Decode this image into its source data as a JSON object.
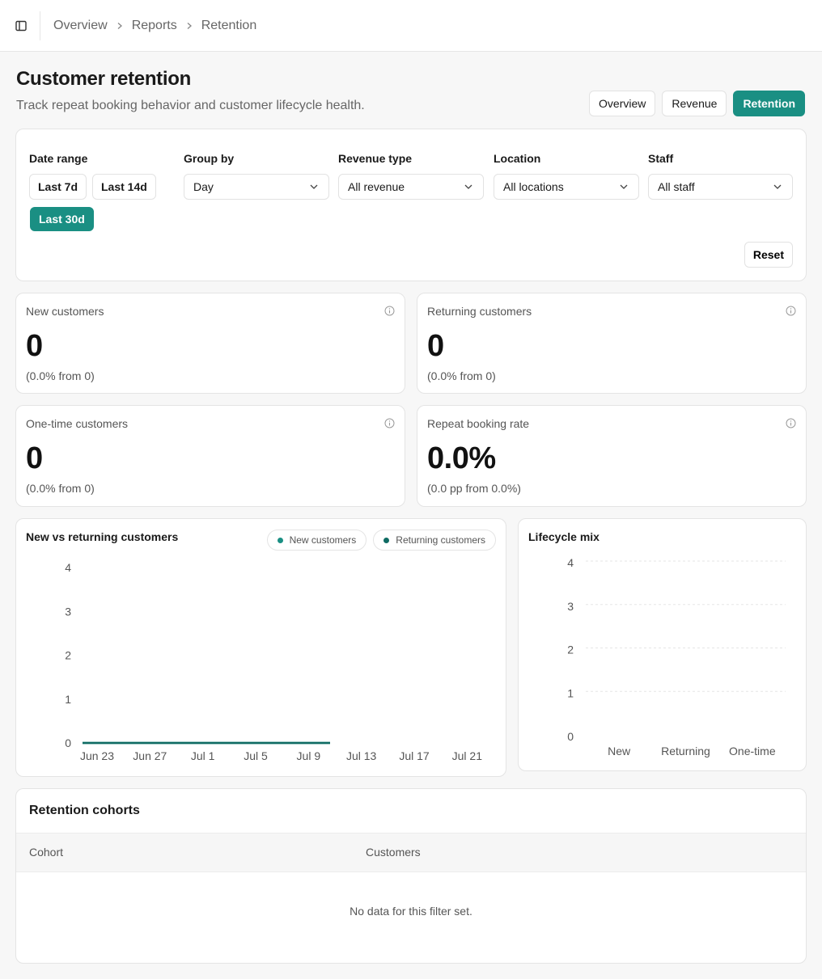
{
  "breadcrumb": [
    "Overview",
    "Reports",
    "Retention"
  ],
  "page": {
    "title": "Customer retention",
    "subtitle": "Track repeat booking behavior and customer lifecycle health."
  },
  "view_tabs": [
    {
      "label": "Overview",
      "active": false
    },
    {
      "label": "Revenue",
      "active": false
    },
    {
      "label": "Retention",
      "active": true
    }
  ],
  "filters": {
    "date_range": {
      "label": "Date range",
      "options": [
        "Last 7d",
        "Last 14d",
        "Last 30d"
      ],
      "selected": "Last 30d"
    },
    "group_by": {
      "label": "Group by",
      "value": "Day"
    },
    "revenue_type": {
      "label": "Revenue type",
      "value": "All revenue"
    },
    "location": {
      "label": "Location",
      "value": "All locations"
    },
    "staff": {
      "label": "Staff",
      "value": "All staff"
    },
    "reset_label": "Reset"
  },
  "metrics": [
    {
      "label": "New customers",
      "value": "0",
      "delta": "(0.0% from 0)"
    },
    {
      "label": "Returning customers",
      "value": "0",
      "delta": "(0.0% from 0)"
    },
    {
      "label": "One-time customers",
      "value": "0",
      "delta": "(0.0% from 0)"
    },
    {
      "label": "Repeat booking rate",
      "value": "0.0%",
      "delta": "(0.0 pp from 0.0%)"
    }
  ],
  "colors": {
    "accent": "#1a8f83",
    "returning": "#0f6b63"
  },
  "chart_data": [
    {
      "type": "line",
      "title": "New vs returning customers",
      "x_ticks": [
        "Jun 23",
        "Jun 27",
        "Jul 1",
        "Jul 5",
        "Jul 9",
        "Jul 13",
        "Jul 17",
        "Jul 21"
      ],
      "x_start": "Jun 23",
      "x_end": "Jul 23",
      "data_end": "Jul 11",
      "series": [
        {
          "name": "New customers",
          "color": "#1a8f83",
          "values_constant": 0
        },
        {
          "name": "Returning customers",
          "color": "#0f6b63",
          "values_constant": 0
        }
      ],
      "ylim": [
        0,
        4
      ],
      "y_ticks": [
        0,
        1,
        2,
        3,
        4
      ],
      "legend": "top-right",
      "grid": false
    },
    {
      "type": "bar",
      "title": "Lifecycle mix",
      "categories": [
        "New",
        "Returning",
        "One-time"
      ],
      "values": [
        0,
        0,
        0
      ],
      "ylim": [
        0,
        4
      ],
      "y_ticks": [
        0,
        1,
        2,
        3,
        4
      ],
      "grid": true
    }
  ],
  "cohorts": {
    "title": "Retention cohorts",
    "columns": [
      "Cohort",
      "Customers"
    ],
    "empty_message": "No data for this filter set."
  }
}
